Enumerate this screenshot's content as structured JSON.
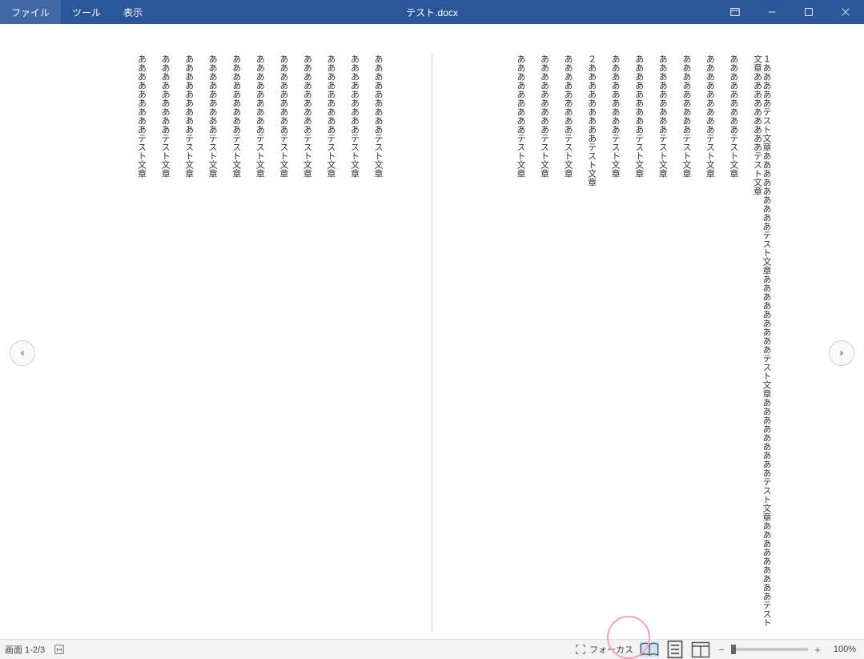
{
  "titlebar": {
    "menu": {
      "file": "ファイル",
      "tool": "ツール",
      "view": "表示"
    },
    "title": "テスト.docx"
  },
  "document": {
    "page2_columns": [
      "あああああああああテスト文章",
      "あああああああああテスト文章",
      "あああああああああテスト文章",
      "あああああああああテスト文章",
      "あああああああああテスト文章",
      "あああああああああテスト文章",
      "あああああああああテスト文章",
      "あああああああああテスト文章",
      "あああああああああテスト文章",
      "あああああああああテスト文章",
      "あああああああああテスト文章"
    ],
    "page1_columns": [
      "１あああああテスト文章あああああああああテスト文章あああああああああテスト文章あああああああああテスト文章あああああああああテスト文章あああああああああテスト文章",
      "あああああああああテスト文章",
      "あああああああああテスト文章",
      "あああああああああテスト文章",
      "あああああああああテスト文章",
      "あああああああああテスト文章",
      "あああああああああテスト文章",
      "２あああああああああテスト文章",
      "あああああああああテスト文章",
      "あああああああああテスト文章",
      "あああああああああテスト文章"
    ]
  },
  "statusbar": {
    "page_indicator": "画面 1-2/3",
    "focus_label": "フォーカス",
    "zoom_value": "100%"
  }
}
